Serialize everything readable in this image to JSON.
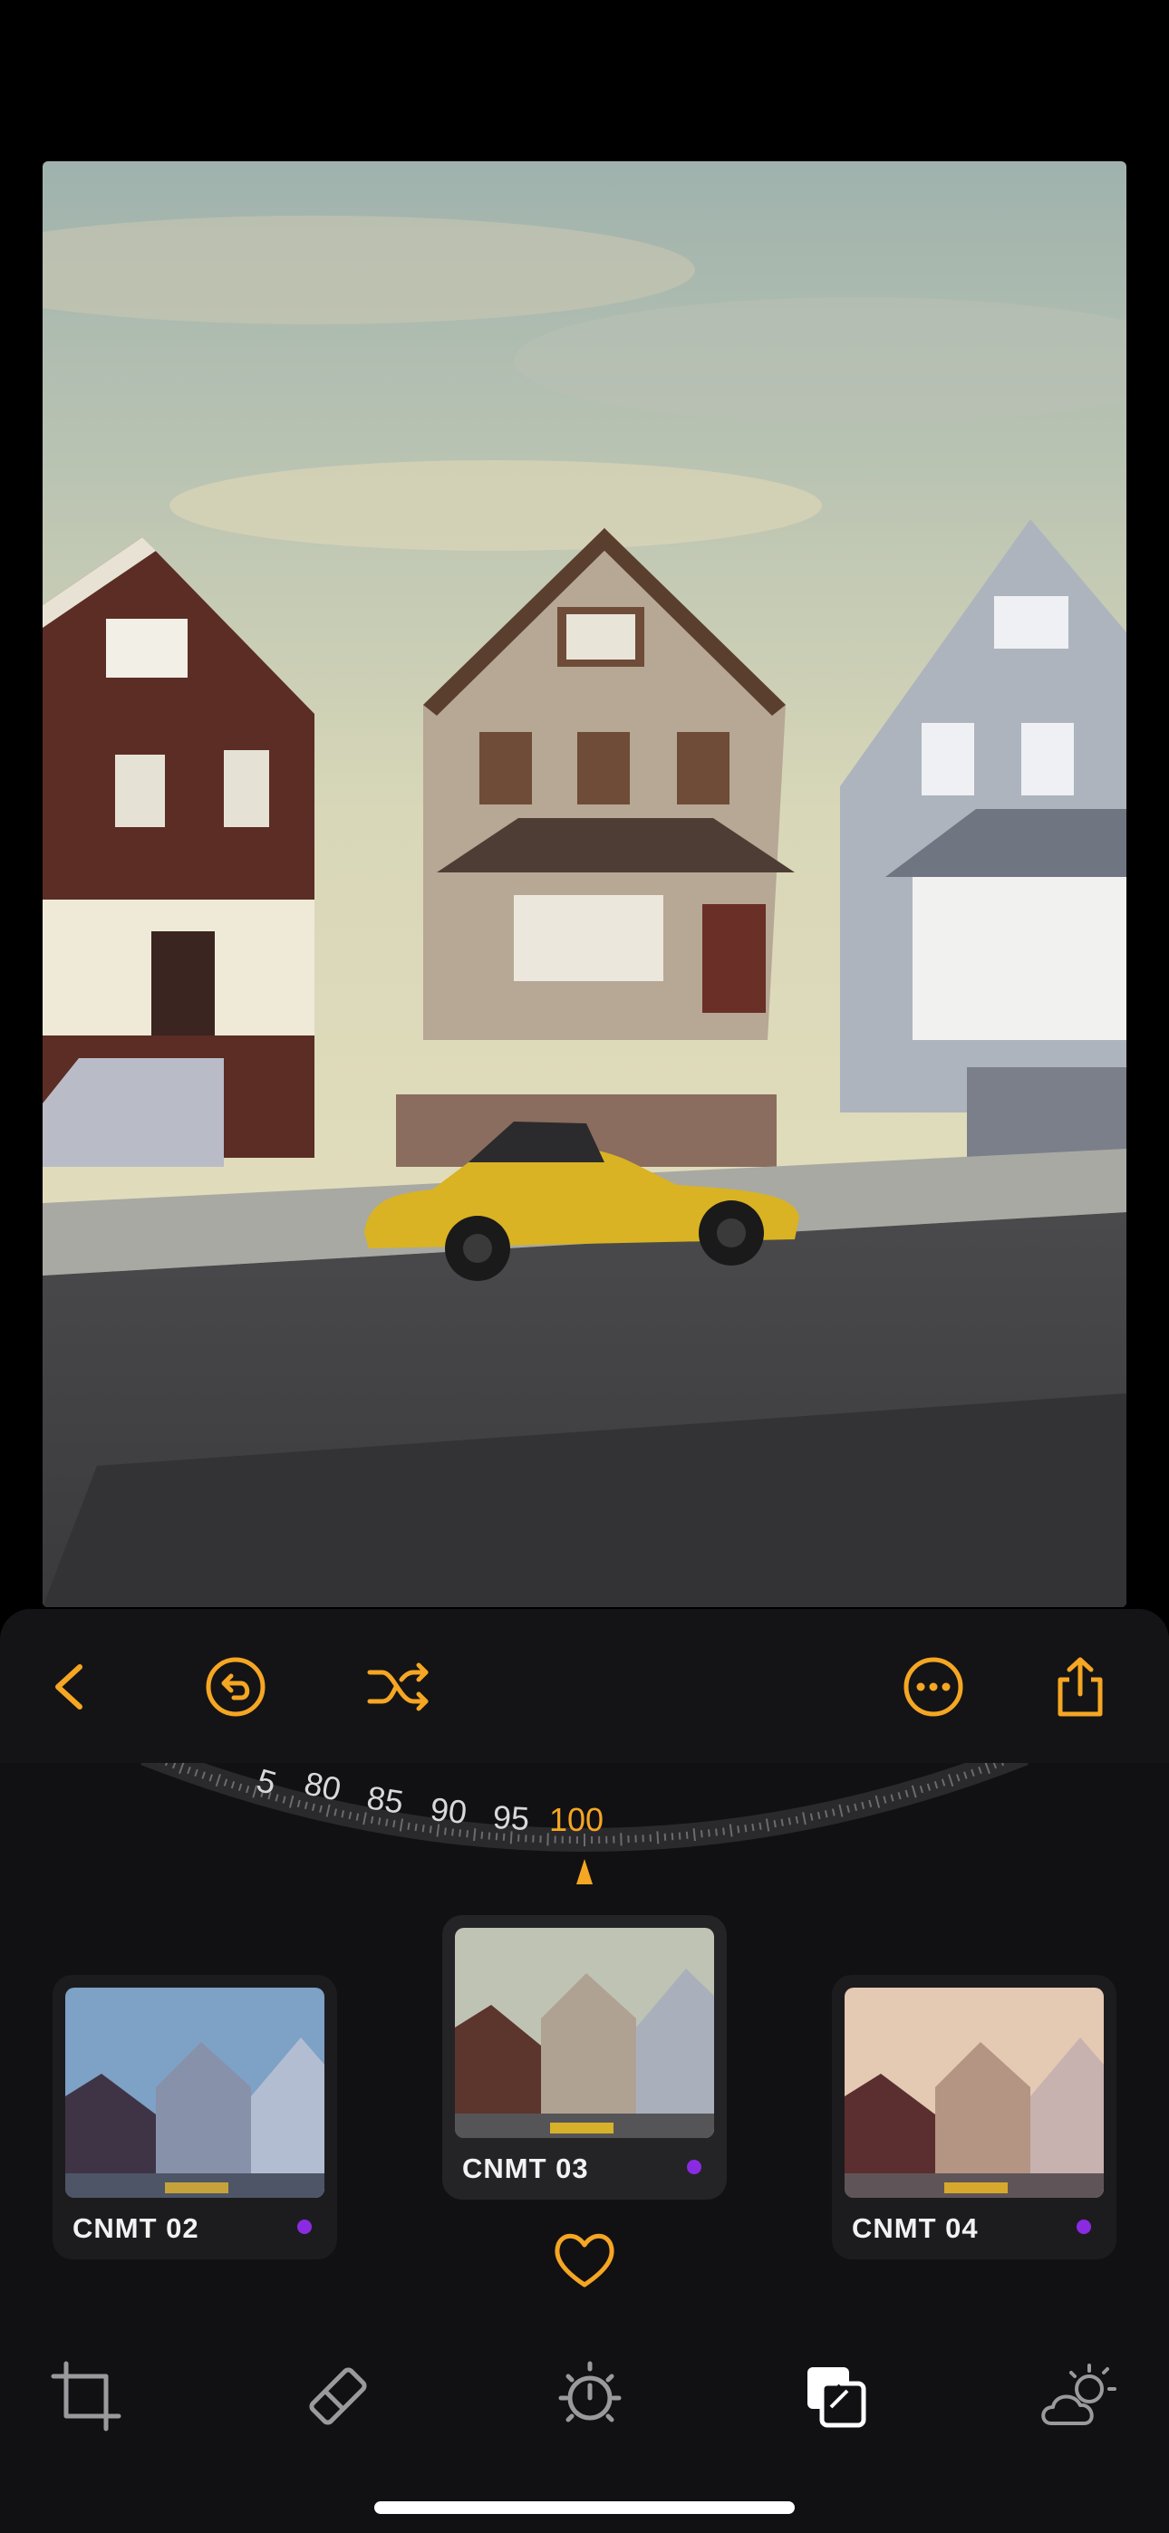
{
  "colors": {
    "accent": "#f5a623",
    "panel": "#111113",
    "card": "#1c1c1e",
    "preset_dot": "#8a2be2"
  },
  "toolbar": {
    "back_icon": "chevron-left-icon",
    "undo_icon": "undo-icon",
    "shuffle_icon": "shuffle-icon",
    "more_icon": "more-icon",
    "share_icon": "share-icon"
  },
  "intensity_dial": {
    "ticks": [
      "5",
      "80",
      "85",
      "90",
      "95",
      "100"
    ],
    "selected": "100",
    "value": 100
  },
  "presets": [
    {
      "name": "CNMT 02",
      "selected": false,
      "tone": "cool"
    },
    {
      "name": "CNMT 03",
      "selected": true,
      "tone": "neutral"
    },
    {
      "name": "CNMT 04",
      "selected": false,
      "tone": "warm"
    }
  ],
  "favorite_icon": "heart-icon",
  "bottom_tools": [
    {
      "icon": "crop-icon",
      "active": false
    },
    {
      "icon": "eraser-icon",
      "active": false
    },
    {
      "icon": "adjust-icon",
      "active": false
    },
    {
      "icon": "filters-icon",
      "active": true
    },
    {
      "icon": "weather-icon",
      "active": false
    }
  ]
}
